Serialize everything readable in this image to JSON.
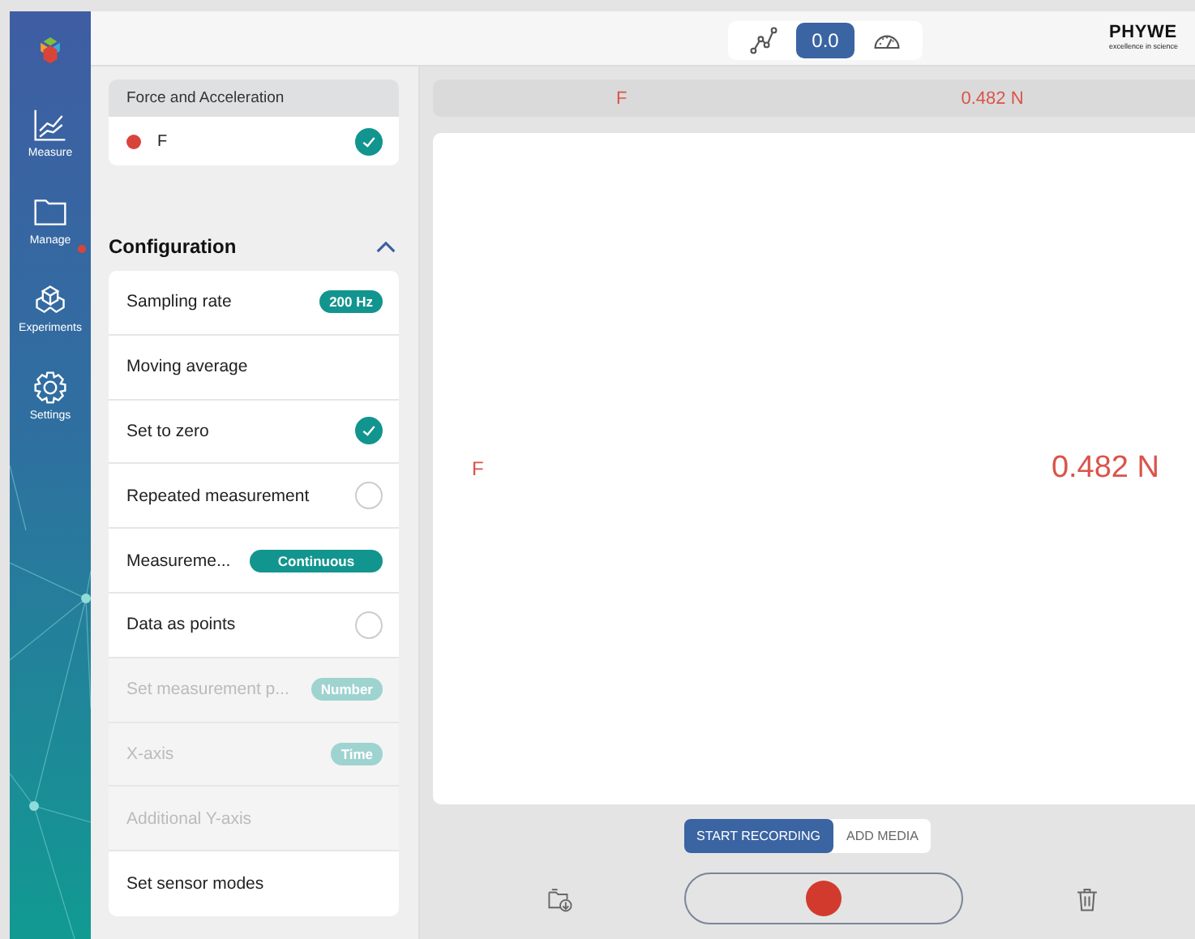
{
  "nav": [
    {
      "label": "Measure",
      "alert": false
    },
    {
      "label": "Manage",
      "alert": true
    },
    {
      "label": "Experiments",
      "alert": false
    },
    {
      "label": "Settings",
      "alert": false
    }
  ],
  "view_switch": [
    {
      "kind": "graph",
      "selected": false
    },
    {
      "kind": "text",
      "label": "0.0",
      "selected": true
    },
    {
      "kind": "gauge",
      "selected": false
    }
  ],
  "logo": {
    "name": "PHYWE",
    "tagline": "excellence in science"
  },
  "sensor": {
    "title": "Force and Acceleration",
    "channels": [
      {
        "name": "F",
        "color": "#d9443a",
        "checked": true
      }
    ]
  },
  "configuration": {
    "title": "Configuration",
    "expanded": true,
    "rows": [
      {
        "kind": "badge",
        "label": "Sampling rate",
        "value": "200 Hz",
        "disabled": false
      },
      {
        "kind": "plain",
        "label": "Moving average",
        "disabled": false
      },
      {
        "kind": "checkbox",
        "label": "Set to zero",
        "checked": true,
        "disabled": false
      },
      {
        "kind": "checkbox",
        "label": "Repeated measurement",
        "checked": false,
        "disabled": false
      },
      {
        "kind": "wide_badge",
        "label": "Measureme...",
        "value": "Continuous",
        "disabled": false
      },
      {
        "kind": "checkbox",
        "label": "Data as points",
        "checked": false,
        "disabled": false
      },
      {
        "kind": "badge",
        "label": "Set measurement p...",
        "value": "Number",
        "disabled": true
      },
      {
        "kind": "badge",
        "label": "X-axis",
        "value": "Time",
        "disabled": true
      },
      {
        "kind": "plain",
        "label": "Additional Y-axis",
        "disabled": true
      },
      {
        "kind": "plain",
        "label": "Set sensor modes",
        "disabled": false
      }
    ]
  },
  "value_bar": {
    "name": "F",
    "reading": "0.482 N"
  },
  "display": {
    "name": "F",
    "reading": "0.482 N"
  },
  "record_tabs": [
    {
      "label": "START RECORDING",
      "selected": true
    },
    {
      "label": "ADD MEDIA",
      "selected": false
    }
  ]
}
